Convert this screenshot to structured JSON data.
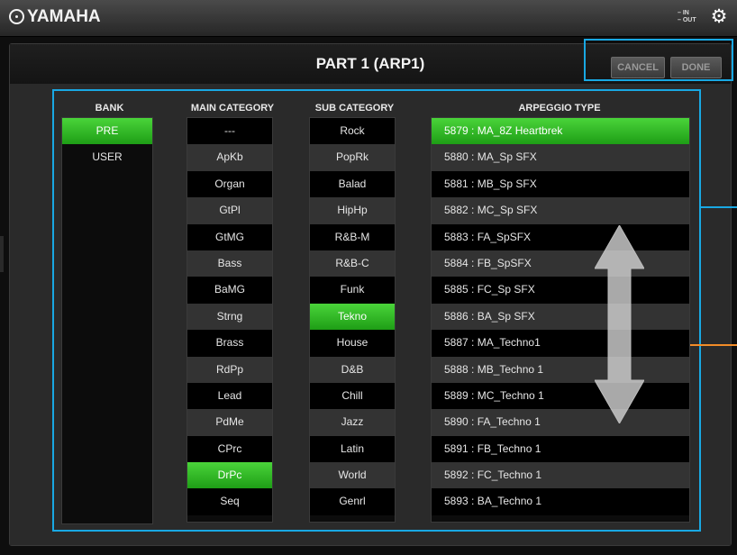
{
  "app": {
    "brand": "YAMAHA",
    "io_in": "IN",
    "io_out": "OUT"
  },
  "header": {
    "title": "PART 1 (ARP1)",
    "cancel_label": "CANCEL",
    "done_label": "DONE"
  },
  "columns": {
    "bank": "BANK",
    "main": "MAIN CATEGORY",
    "sub": "SUB CATEGORY",
    "arp": "ARPEGGIO TYPE"
  },
  "bank_items": [
    "PRE",
    "USER"
  ],
  "bank_selected": 0,
  "main_items": [
    "---",
    "ApKb",
    "Organ",
    "GtPl",
    "GtMG",
    "Bass",
    "BaMG",
    "Strng",
    "Brass",
    "RdPp",
    "Lead",
    "PdMe",
    "CPrc",
    "DrPc",
    "Seq"
  ],
  "main_selected": 13,
  "sub_items": [
    "Rock",
    "PopRk",
    "Balad",
    "HipHp",
    "R&B-M",
    "R&B-C",
    "Funk",
    "Tekno",
    "House",
    "D&B",
    "Chill",
    "Jazz",
    "Latin",
    "World",
    "Genrl"
  ],
  "sub_selected": 7,
  "arp_items": [
    "5879 : MA_8Z Heartbrek",
    "5880 : MA_Sp SFX",
    "5881 : MB_Sp SFX",
    "5882 : MC_Sp SFX",
    "5883 : FA_SpSFX",
    "5884 : FB_SpSFX",
    "5885 : FC_Sp SFX",
    "5886 : BA_Sp SFX",
    "5887 : MA_Techno1",
    "5888 : MB_Techno 1",
    "5889 : MC_Techno 1",
    "5890 : FA_Techno 1",
    "5891 : FB_Techno 1",
    "5892 : FC_Techno 1",
    "5893 : BA_Techno 1"
  ],
  "arp_selected": 0,
  "colors": {
    "highlight": "#19a8e3",
    "callout": "#f28c28",
    "selected": "#2fb824"
  }
}
